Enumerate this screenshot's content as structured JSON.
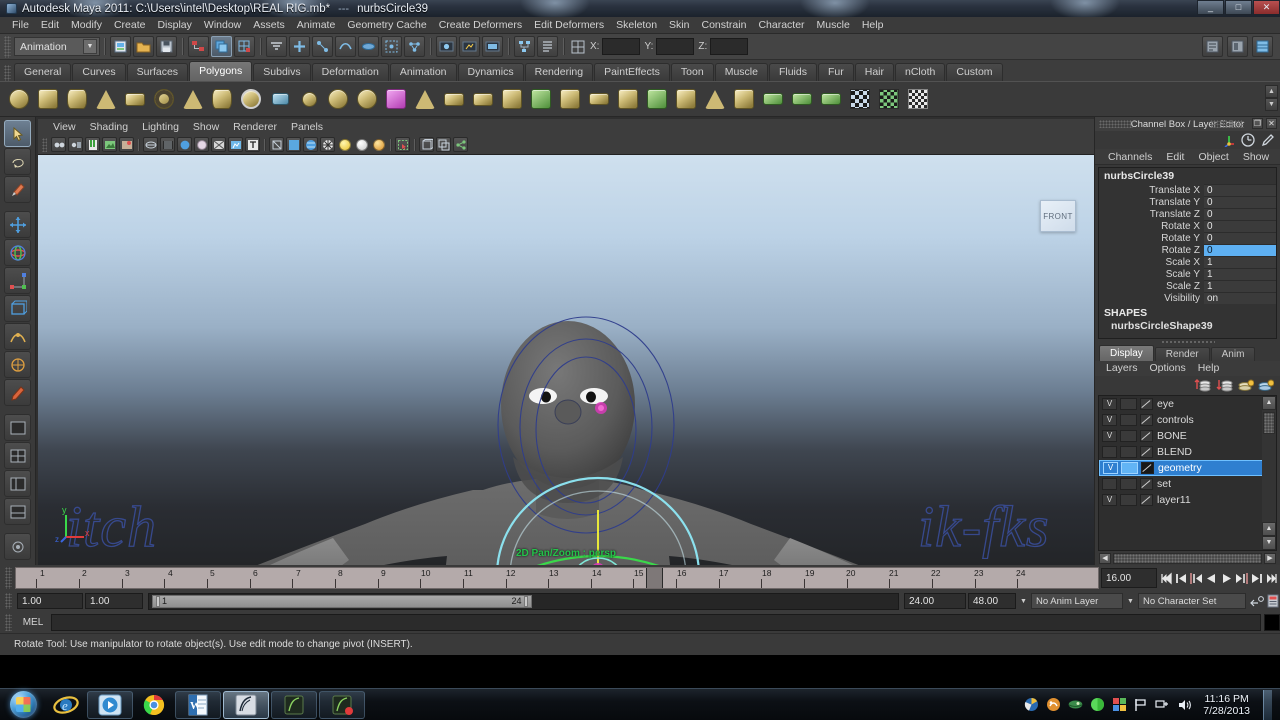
{
  "titlebar": {
    "app_title": "Autodesk Maya 2011: C:\\Users\\intel\\Desktop\\REAL RIG.mb*",
    "separator": "---",
    "selection": "nurbsCircle39",
    "minimize": "_",
    "maximize": "□",
    "close": "✕"
  },
  "menubar": {
    "items": [
      {
        "label": "File"
      },
      {
        "label": "Edit"
      },
      {
        "label": "Modify"
      },
      {
        "label": "Create"
      },
      {
        "label": "Display"
      },
      {
        "label": "Window"
      },
      {
        "label": "Assets"
      },
      {
        "label": "Animate"
      },
      {
        "label": "Geometry Cache"
      },
      {
        "label": "Create Deformers"
      },
      {
        "label": "Edit Deformers"
      },
      {
        "label": "Skeleton"
      },
      {
        "label": "Skin"
      },
      {
        "label": "Constrain"
      },
      {
        "label": "Character"
      },
      {
        "label": "Muscle"
      },
      {
        "label": "Help"
      }
    ]
  },
  "statusline": {
    "menu_set": "Animation",
    "coords": {
      "x_label": "X:",
      "x_value": "",
      "y_label": "Y:",
      "y_value": "",
      "z_label": "Z:",
      "z_value": ""
    }
  },
  "shelf": {
    "tabs": [
      {
        "label": "General"
      },
      {
        "label": "Curves"
      },
      {
        "label": "Surfaces"
      },
      {
        "label": "Polygons"
      },
      {
        "label": "Subdivs"
      },
      {
        "label": "Deformation"
      },
      {
        "label": "Animation"
      },
      {
        "label": "Dynamics"
      },
      {
        "label": "Rendering"
      },
      {
        "label": "PaintEffects"
      },
      {
        "label": "Toon"
      },
      {
        "label": "Muscle"
      },
      {
        "label": "Fluids"
      },
      {
        "label": "Fur"
      },
      {
        "label": "Hair"
      },
      {
        "label": "nCloth"
      },
      {
        "label": "Custom"
      }
    ],
    "active_tab": "Polygons"
  },
  "viewport": {
    "menus": [
      {
        "label": "View"
      },
      {
        "label": "Shading"
      },
      {
        "label": "Lighting"
      },
      {
        "label": "Show"
      },
      {
        "label": "Renderer"
      },
      {
        "label": "Panels"
      }
    ],
    "viewcube_label": "FRONT",
    "hud_text": "2D Pan/Zoom : persp",
    "axis_x": "x",
    "axis_y": "y",
    "axis_z": "z",
    "annotation_left": "itch",
    "annotation_right": "ik-fks"
  },
  "channelbox": {
    "panel_title": "Channel Box / Layer Editor",
    "menus": [
      {
        "label": "Channels"
      },
      {
        "label": "Edit"
      },
      {
        "label": "Object"
      },
      {
        "label": "Show"
      }
    ],
    "node_name": "nurbsCircle39",
    "attributes": [
      {
        "label": "Translate X",
        "value": "0",
        "selected": false
      },
      {
        "label": "Translate Y",
        "value": "0",
        "selected": false
      },
      {
        "label": "Translate Z",
        "value": "0",
        "selected": false
      },
      {
        "label": "Rotate X",
        "value": "0",
        "selected": false
      },
      {
        "label": "Rotate Y",
        "value": "0",
        "selected": false
      },
      {
        "label": "Rotate Z",
        "value": "0",
        "selected": true
      },
      {
        "label": "Scale X",
        "value": "1",
        "selected": false
      },
      {
        "label": "Scale Y",
        "value": "1",
        "selected": false
      },
      {
        "label": "Scale Z",
        "value": "1",
        "selected": false
      },
      {
        "label": "Visibility",
        "value": "on",
        "selected": false
      }
    ],
    "shapes_header": "SHAPES",
    "shape_name": "nurbsCircleShape39"
  },
  "layereditor": {
    "tabs": [
      {
        "label": "Display"
      },
      {
        "label": "Render"
      },
      {
        "label": "Anim"
      }
    ],
    "active_tab": "Display",
    "menus": [
      {
        "label": "Layers"
      },
      {
        "label": "Options"
      },
      {
        "label": "Help"
      }
    ],
    "layers": [
      {
        "name": "eye",
        "visible": "V",
        "selected": false,
        "solid": false
      },
      {
        "name": "controls",
        "visible": "V",
        "selected": false,
        "solid": false
      },
      {
        "name": "BONE",
        "visible": "V",
        "selected": false,
        "solid": false
      },
      {
        "name": "BLEND",
        "visible": "",
        "selected": false,
        "solid": false
      },
      {
        "name": "geometry",
        "visible": "V",
        "selected": true,
        "solid": true
      },
      {
        "name": "set",
        "visible": "",
        "selected": false,
        "solid": false
      },
      {
        "name": "layer11",
        "visible": "V",
        "selected": false,
        "solid": false
      }
    ]
  },
  "timeslider": {
    "ticks": [
      "1",
      "2",
      "3",
      "4",
      "5",
      "6",
      "7",
      "8",
      "9",
      "10",
      "11",
      "12",
      "13",
      "14",
      "15",
      "16",
      "17",
      "18",
      "19",
      "20",
      "21",
      "22",
      "23",
      "24"
    ],
    "current_time": "16.00",
    "playback": [
      {
        "name": "go-to-start"
      },
      {
        "name": "step-back-key"
      },
      {
        "name": "step-back-frame"
      },
      {
        "name": "play-backwards"
      },
      {
        "name": "play-forwards"
      },
      {
        "name": "step-forward-frame"
      },
      {
        "name": "step-forward-key"
      },
      {
        "name": "go-to-end"
      }
    ]
  },
  "rangeslider": {
    "anim_start": "1.00",
    "range_start": "1.00",
    "range_bar_start": "1",
    "range_bar_end": "24",
    "range_end": "24.00",
    "anim_end": "48.00",
    "anim_layer": "No Anim Layer",
    "character_set": "No Character Set"
  },
  "commandline": {
    "mel_label": "MEL",
    "mel_value": "",
    "help_text": "Rotate Tool: Use manipulator to rotate object(s). Use edit mode to change pivot (INSERT)."
  },
  "taskbar": {
    "buttons": [
      {
        "name": "internet-explorer"
      },
      {
        "name": "windows-media-player"
      },
      {
        "name": "google-chrome"
      },
      {
        "name": "microsoft-word"
      },
      {
        "name": "autodesk-maya-active"
      },
      {
        "name": "autodesk-maya-2"
      },
      {
        "name": "autodesk-maya-3"
      }
    ],
    "tray": [
      {
        "name": "tray-icon-1"
      },
      {
        "name": "tray-icon-2"
      },
      {
        "name": "tray-icon-3"
      },
      {
        "name": "tray-icon-4"
      },
      {
        "name": "tray-icon-5"
      },
      {
        "name": "tray-flag-icon"
      },
      {
        "name": "tray-network-icon"
      },
      {
        "name": "tray-volume-icon"
      }
    ],
    "time": "11:16 PM",
    "date": "7/28/2013"
  },
  "colors": {
    "selection_blue": "#5eb0f2",
    "layer_select": "#2f7fd0",
    "hud_green": "#24c24a",
    "timeline_bg": "#b4aaaa",
    "manip_x": "#e03b3b",
    "manip_y": "#3ad84a",
    "manip_z": "#3a66e0",
    "manip_view": "#8ee8f5"
  }
}
